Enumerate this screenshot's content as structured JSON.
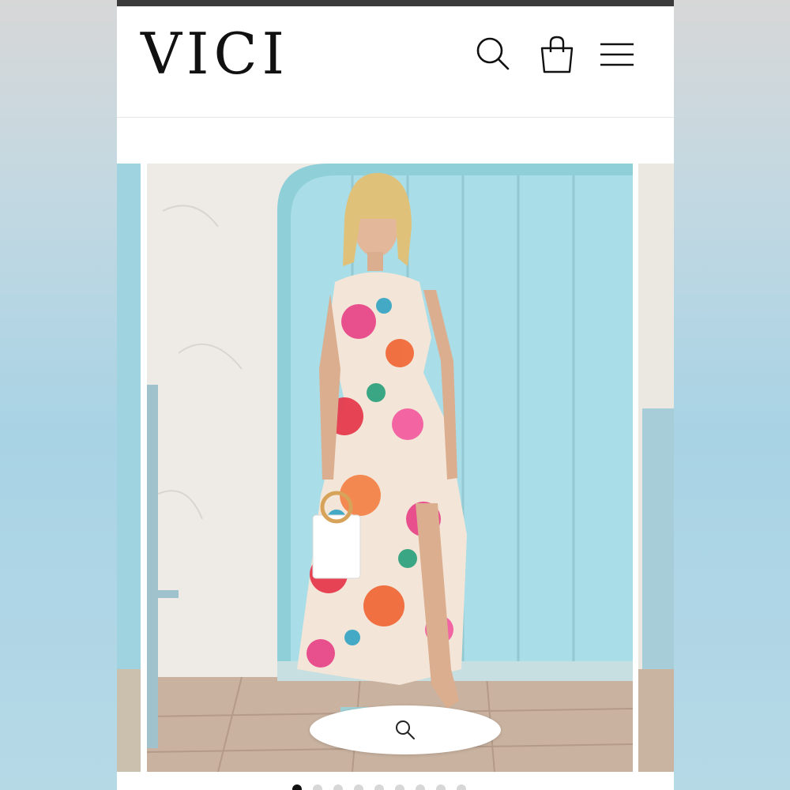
{
  "brand": {
    "name": "VICI"
  },
  "header": {
    "icons": [
      "search-icon",
      "shopping-bag-icon",
      "hamburger-menu-icon"
    ]
  },
  "gallery": {
    "slide_count": 9,
    "active_slide": 1,
    "zoom_icon": "zoom-icon"
  },
  "colors": {
    "background": "#ffffff",
    "topbar": "#3b3b3b",
    "door": "#a8dce6",
    "wall": "#eeebe6",
    "dot_active": "#111111",
    "dot_inactive": "#d7d7d7"
  }
}
